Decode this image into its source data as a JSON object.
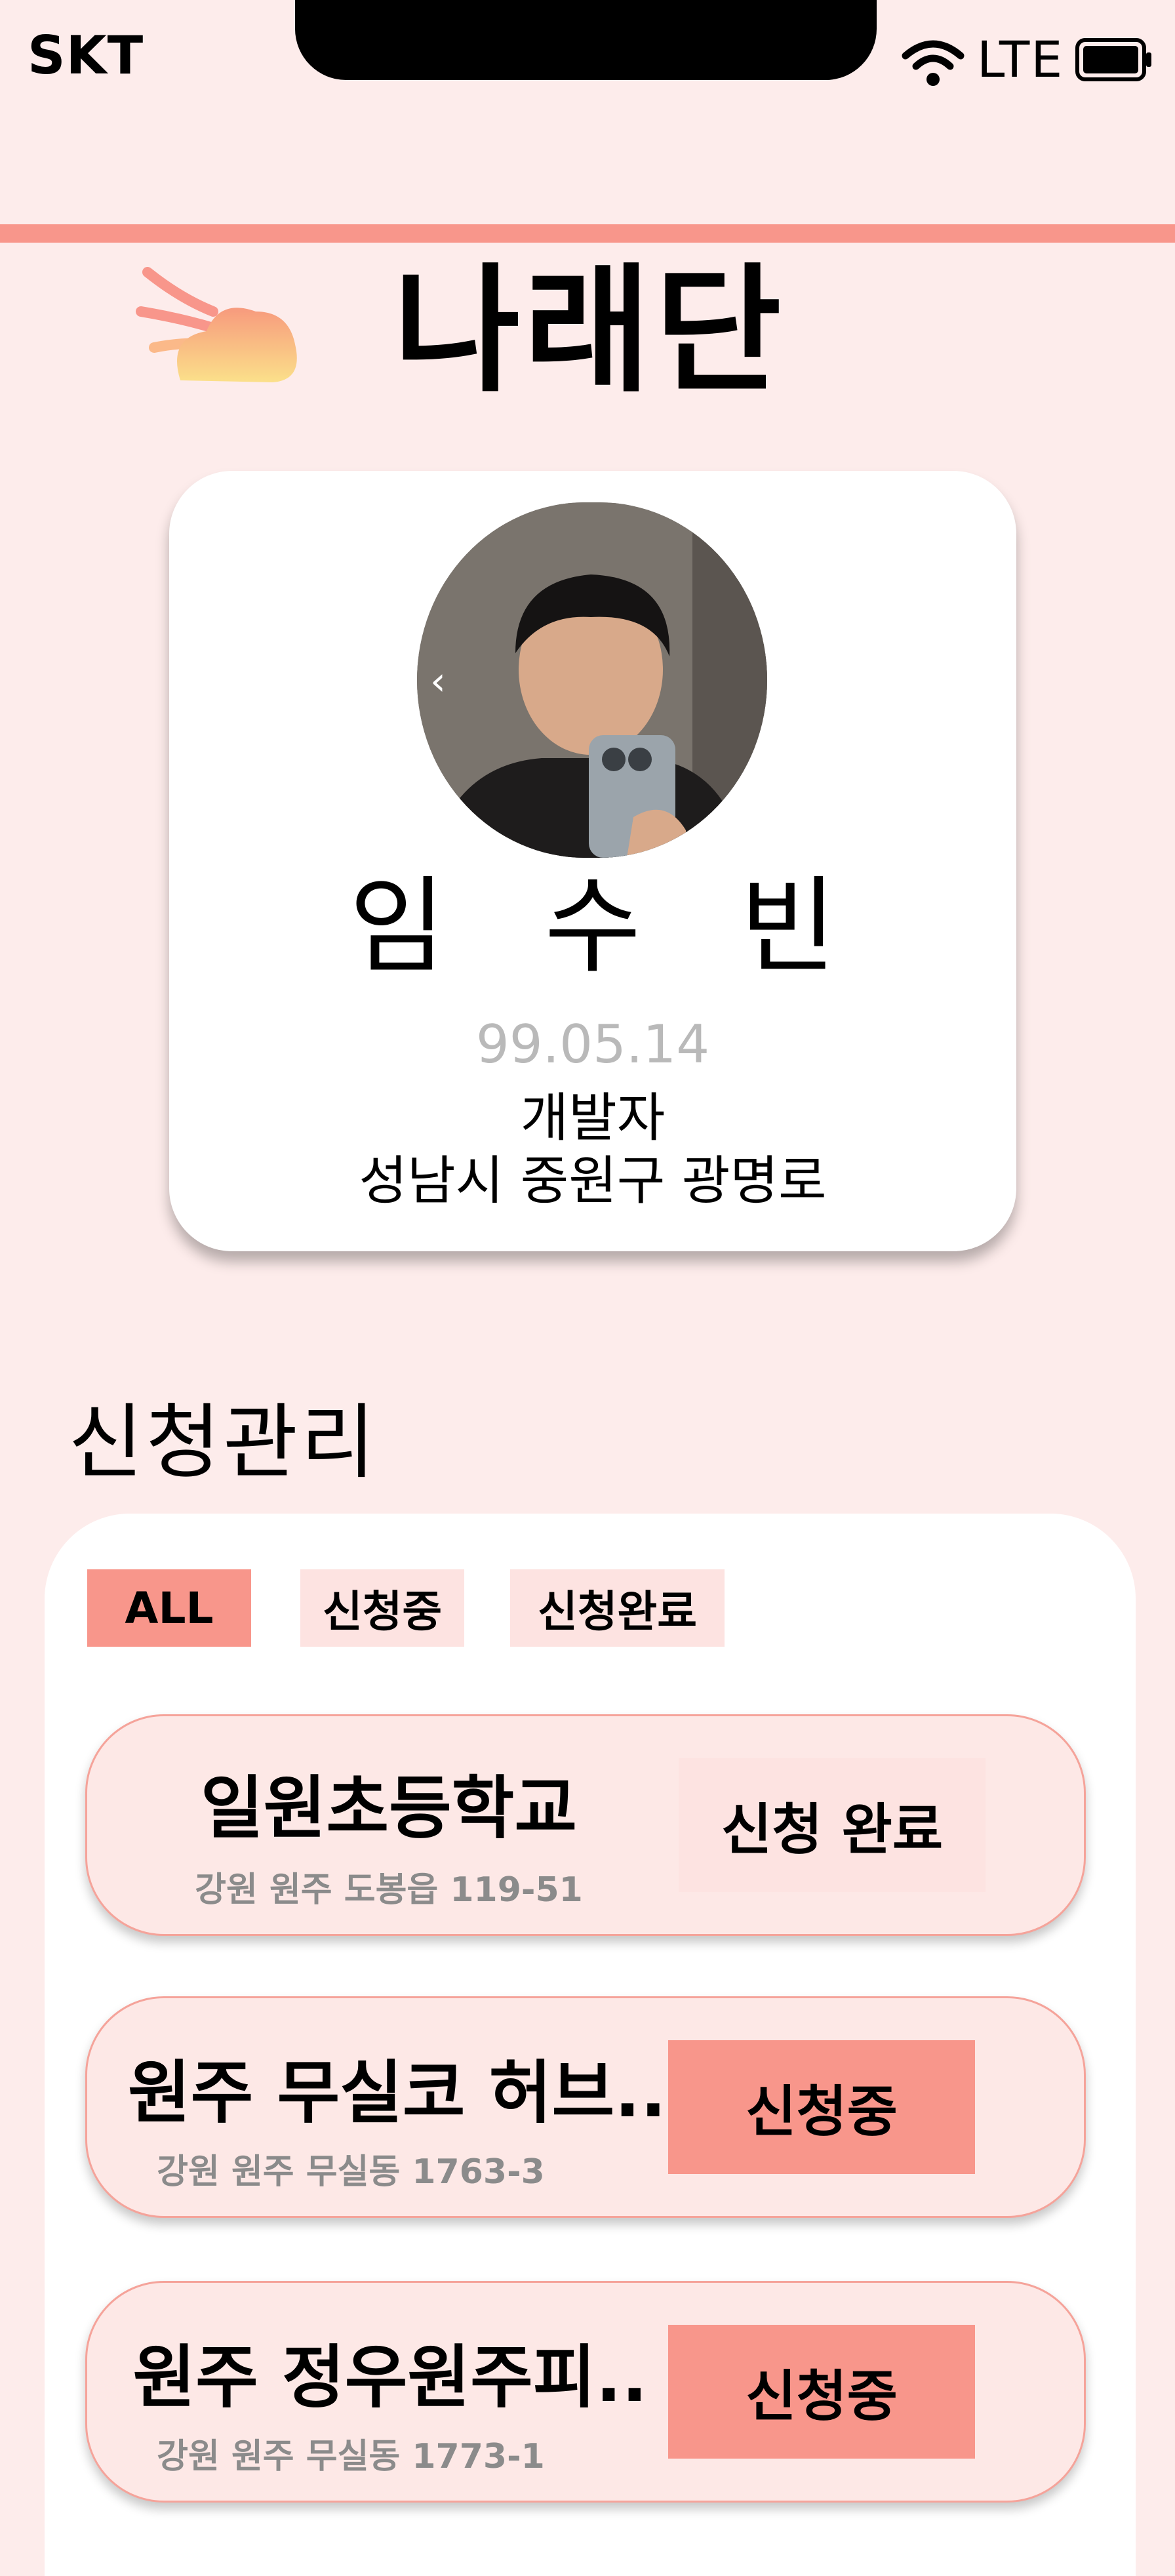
{
  "status_bar": {
    "carrier": "SKT",
    "network": "LTE"
  },
  "app": {
    "title": "나래단"
  },
  "profile": {
    "name": "임 수 빈",
    "birth": "99.05.14",
    "job": "개발자",
    "address": "성남시 중원구 광명로",
    "prev_icon": "‹"
  },
  "section": {
    "title": "신청관리"
  },
  "filters": [
    "ALL",
    "신청중",
    "신청완료"
  ],
  "applications": [
    {
      "name": "일원초등학교",
      "address": "강원 원주 도봉읍 119-51",
      "status": "신청 완료"
    },
    {
      "name": "원주 무실코 허브..",
      "address": "강원 원주 무실동 1763-3",
      "status": "신청중"
    },
    {
      "name": "원주 정우원주피..",
      "address": "강원 원주 무실동 1773-1",
      "status": "신청중"
    }
  ],
  "colors": {
    "background": "#fdeceb",
    "accent": "#f8968b",
    "soft": "#fde3e1"
  }
}
